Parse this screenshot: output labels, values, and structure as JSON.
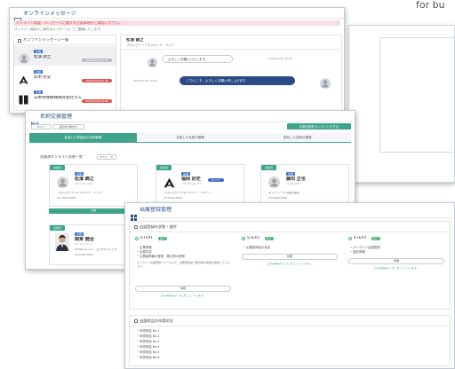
{
  "corner_text": "for bu",
  "colors": {
    "navy": "#2c4a86",
    "teal": "#3ea58c",
    "green": "#4fb477",
    "red": "#e0574f",
    "badge_blue": "#3f6fcf",
    "alert_bg": "#f8dde2",
    "alert_text": "#d04848"
  },
  "messages": {
    "icon": "chat-icon",
    "title": "オンラインメッセージ",
    "alert": "オンライン商談・メッセージに関する注意事項をご確認ください。",
    "notice": "オンライン商談のご案内はメッセージにてご連絡いたします。",
    "list_title": "オンラインメッセージ一覧",
    "threads": [
      {
        "badge": "出展",
        "name": "松濱 錦之",
        "date": "2020/11/30 10:00"
      },
      {
        "badge": "出展",
        "name": "鈴木 好史",
        "date": "2020/11/30 09:30"
      },
      {
        "badge": "出展",
        "name": "日本特殊機械株式会社エムイアクス",
        "date": "2020/11/29 18:00"
      }
    ],
    "chat": {
      "name": "松濱 錦之",
      "org": "プロジェクトマネジメント・アジア",
      "messages": [
        {
          "text": "よろしくお願いいたします。",
          "date": "2020/11/30 10:00"
        },
        {
          "text": "こちらこそ、よろしくお願い申し上げます",
          "date": "2020/11/30 10:05"
        }
      ]
    }
  },
  "cards": {
    "icon": "id-card-icon",
    "title": "名刺交換管理",
    "toolbar": [
      "すべて",
      "名刺を印刷する"
    ],
    "primary_button": "名刺交換をオンラインでする",
    "tabs": [
      "参加した商談会の名刺管理",
      "交換した名刺の管理",
      "保存した名刺の管理"
    ],
    "filter_label": "交換済オンライン名刺一覧",
    "filter_value": "すべて",
    "items": [
      {
        "tag": "交換済",
        "badge": "出展",
        "name": "松濱 錦之",
        "kana": "マツハマ ニシキ",
        "org": "プロジェクトマネジメント・アジア",
        "phone": "03-0000-0000",
        "button": "詳細"
      },
      {
        "tag": "交換済",
        "badge": "出展",
        "name": "福岡 好史",
        "kana": "フクオカ ヨシフミ",
        "pill": "メンバー",
        "org": "プロジェクトマネジメント・グループ",
        "phone": "03-0000-0000"
      },
      {
        "tag": "交換済",
        "badge": "出展",
        "name": "藤田 正也",
        "kana": "フジタ マサヤ",
        "org": "ネットワークス株式会社",
        "phone": "03-0000-0000"
      },
      {
        "tag": "交換済",
        "badge": "出展",
        "name": "関東 健治",
        "kana": "カントウ ケンジ",
        "org": "ITマネジメント・コンサルティング",
        "phone": "03-0000-0000"
      }
    ]
  },
  "exhibit": {
    "icon": "grid-icon",
    "title": "出展登録管理",
    "progress_title": "出展登録の状態・進捗",
    "steps": [
      {
        "label": "STEP1",
        "badge": "完了",
        "items": [
          "企業情報",
          "出展内容",
          "出展者情報の登録・展示物の登録"
        ],
        "note": "オンライン出展登録フォームより、出展者情報と展示物の情報を登録してください。",
        "button": "詳細",
        "link": "上の項目はすでに完了しています。"
      },
      {
        "label": "STEP2",
        "badge": "完了",
        "items": [
          "出展説明会の参加"
        ],
        "button": "詳細",
        "link": "上の項目はすでに完了しています。"
      },
      {
        "label": "STEP3",
        "badge": "完了",
        "items": [
          "オンライン出展登録",
          "製品情報"
        ],
        "button": "詳細",
        "link": "上の項目はすでに完了しています。"
      }
    ],
    "products_title": "出展商品の申請状況",
    "products": [
      "申請商品 No.1",
      "申請商品 No.2",
      "申請商品 No.3",
      "申請商品 No.4",
      "申請商品 No.5",
      "申請商品 No.6"
    ]
  }
}
